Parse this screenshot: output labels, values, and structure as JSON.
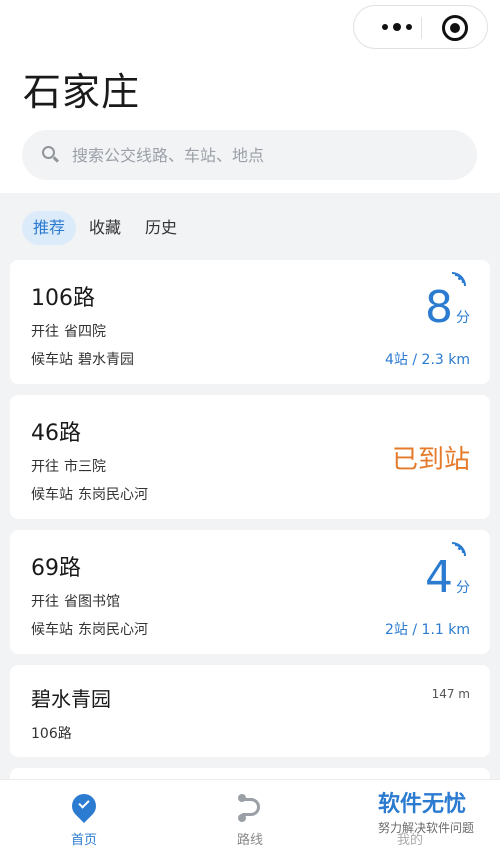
{
  "header": {
    "city": "石家庄",
    "search_placeholder": "搜索公交线路、车站、地点"
  },
  "capsule": {
    "more_icon": "more-dots-icon",
    "close_icon": "target-circle-icon"
  },
  "tabs": [
    {
      "label": "推荐",
      "active": true
    },
    {
      "label": "收藏",
      "active": false
    },
    {
      "label": "历史",
      "active": false
    }
  ],
  "cards": [
    {
      "route": "106路",
      "direction_label": "开往",
      "direction": "省四院",
      "stop_label": "候车站",
      "stop": "碧水青园",
      "eta_value": "8",
      "eta_unit": "分",
      "distance": "4站 / 2.3 km"
    },
    {
      "route": "46路",
      "direction_label": "开往",
      "direction": "市三院",
      "stop_label": "候车站",
      "stop": "东岗民心河",
      "status": "已到站"
    },
    {
      "route": "69路",
      "direction_label": "开往",
      "direction": "省图书馆",
      "stop_label": "候车站",
      "stop": "东岗民心河",
      "eta_value": "4",
      "eta_unit": "分",
      "distance": "2站 / 1.1 km"
    },
    {
      "station": "碧水青园",
      "meters": "147 m",
      "routes": "106路"
    }
  ],
  "tabbar": {
    "home": "首页",
    "route": "路线",
    "me": "我的"
  },
  "watermark": {
    "title": "软件无忧",
    "subtitle": "努力解决软件问题"
  },
  "colors": {
    "accent": "#2b7bd1",
    "arrived": "#e57a2a",
    "background": "#f2f3f5"
  }
}
